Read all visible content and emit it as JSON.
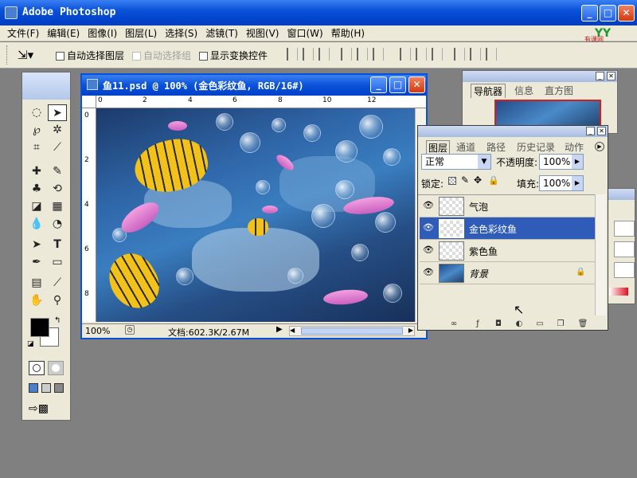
{
  "app": {
    "title": "Adobe Photoshop",
    "watermark": "有课网"
  },
  "menu": [
    "文件(F)",
    "编辑(E)",
    "图像(I)",
    "图层(L)",
    "选择(S)",
    "滤镜(T)",
    "视图(V)",
    "窗口(W)",
    "帮助(H)"
  ],
  "options": {
    "auto_select_layer": "自动选择图层",
    "auto_select_group": "自动选择组",
    "show_transform": "显示变换控件"
  },
  "document": {
    "title": "鱼11.psd @ 100% (金色彩纹鱼, RGB/16#)",
    "ruler_h": [
      "0",
      "2",
      "4",
      "6",
      "8",
      "10",
      "12"
    ],
    "ruler_v": [
      "0",
      "2",
      "4",
      "6",
      "8"
    ],
    "zoom": "100%",
    "doc_size": "文档:602.3K/2.67M"
  },
  "navigator": {
    "tabs": [
      "导航器",
      "信息",
      "直方图"
    ]
  },
  "layers_panel": {
    "tabs": [
      "图层",
      "通道",
      "路径",
      "历史记录",
      "动作"
    ],
    "blend_mode": "正常",
    "opacity_label": "不透明度:",
    "opacity_value": "100%",
    "lock_label": "锁定:",
    "fill_label": "填充:",
    "fill_value": "100%",
    "layers": [
      {
        "name": "气泡",
        "visible": true,
        "active": false
      },
      {
        "name": "金色彩纹鱼",
        "visible": true,
        "active": true
      },
      {
        "name": "紫色鱼",
        "visible": true,
        "active": false
      },
      {
        "name": "背景",
        "visible": true,
        "active": false,
        "locked": true
      }
    ]
  },
  "colors": {
    "xp_blue": "#0a52d8",
    "active_layer": "#2f5cb8",
    "foreground": "#000000",
    "background": "#ffffff"
  }
}
